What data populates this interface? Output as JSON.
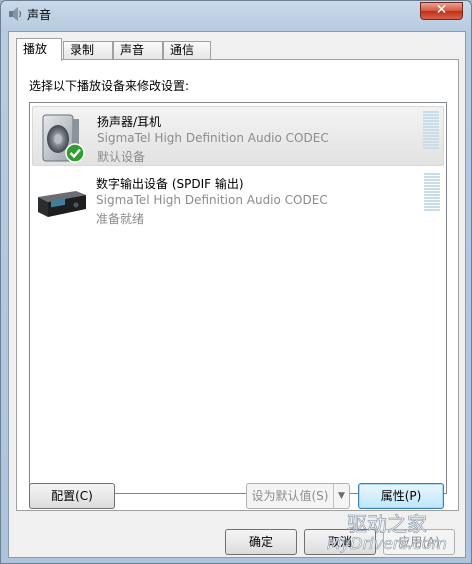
{
  "window": {
    "title": "声音",
    "close_label": "✕"
  },
  "tabs": [
    {
      "label": "播放",
      "active": true
    },
    {
      "label": "录制",
      "active": false
    },
    {
      "label": "声音",
      "active": false
    },
    {
      "label": "通信",
      "active": false
    }
  ],
  "playback": {
    "instruction": "选择以下播放设备来修改设置:",
    "devices": [
      {
        "name": "扬声器/耳机",
        "driver": "SigmaTel High Definition Audio CODEC",
        "status": "默认设备",
        "selected": true,
        "icon": "speaker-icon"
      },
      {
        "name": "数字输出设备 (SPDIF 输出)",
        "driver": "SigmaTel High Definition Audio CODEC",
        "status": "准备就绪",
        "selected": false,
        "icon": "digital-output-icon"
      }
    ]
  },
  "buttons": {
    "configure": "配置(C)",
    "set_default": "设为默认值(S)",
    "properties": "属性(P)",
    "ok": "确定",
    "cancel": "取消",
    "apply": "应用(A)"
  },
  "watermark": {
    "text": "驱动之家",
    "url": "MyDrivers.com"
  },
  "colors": {
    "accent": "#3c7fb1",
    "check_green": "#2f9e2f",
    "meter": "#c9dcea"
  }
}
